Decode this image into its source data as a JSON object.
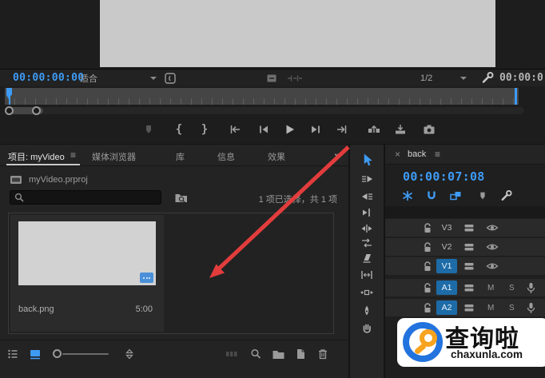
{
  "monitor": {
    "current_timecode": "00:00:00:00",
    "zoom_level": "适合",
    "playback_resolution": "1/2",
    "duration_timecode": "00:00:0"
  },
  "transport": {
    "mark_in": "{",
    "mark_out": "}"
  },
  "project": {
    "tabs": [
      {
        "label": "项目: myVideo"
      },
      {
        "label": "媒体浏览器"
      },
      {
        "label": "库"
      },
      {
        "label": "信息"
      },
      {
        "label": "效果"
      }
    ],
    "menu_glyph": "≡",
    "overflow_chevron": "»",
    "file_name": "myVideo.prproj",
    "selection_status": "1 项已选择，共 1 项",
    "items": [
      {
        "name": "back.png",
        "duration": "5:00"
      }
    ]
  },
  "timeline": {
    "tab_label": "back",
    "close_glyph": "×",
    "menu_glyph": "≡",
    "timecode": "00:00:07:08",
    "mute_label": "M",
    "solo_label": "S",
    "tracks": [
      {
        "label": "V3",
        "type": "video",
        "targeted": false
      },
      {
        "label": "V2",
        "type": "video",
        "targeted": false
      },
      {
        "label": "V1",
        "type": "video",
        "targeted": true
      },
      {
        "label": "A1",
        "type": "audio",
        "targeted": true
      },
      {
        "label": "A2",
        "type": "audio",
        "targeted": true
      }
    ]
  },
  "watermark": {
    "title": "查询啦",
    "url": "chaxunla.com"
  },
  "colors": {
    "accent_blue": "#3e9bf4",
    "target_track_blue": "#1d6ca8",
    "arrow_red": "#e23c3c",
    "badge_blue": "#4a90d9",
    "panel_bg": "#232323"
  },
  "icons": {
    "marker": "pentagon",
    "go-to-in": "bar+left-arrow",
    "step-back": "bar+left-triangle",
    "play": "right-triangle",
    "step-forward": "bar+right-triangle",
    "go-to-out": "right-arrow+bar",
    "lift": "frames+up-arrow",
    "overwrite": "frame+down-arrow",
    "export-frame": "camera",
    "search": "magnifier",
    "new-bin": "folder",
    "new-item": "page",
    "delete": "trash",
    "snap": "magnet",
    "settings": "wrench",
    "track-lock": "padlock",
    "toggle-track-output": "eye",
    "voiceover": "microphone",
    "selection-tool": "cursor-arrow"
  }
}
